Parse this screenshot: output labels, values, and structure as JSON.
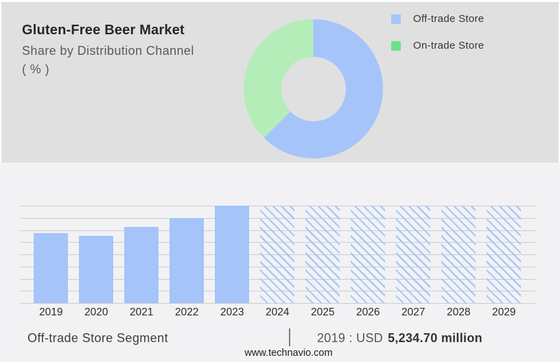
{
  "header": {
    "title": "Gluten-Free Beer Market",
    "subtitle": "Share by Distribution Channel",
    "unit": "( % )"
  },
  "legend": [
    {
      "label": "Off-trade Store",
      "color": "#a5c4fa"
    },
    {
      "label": "On-trade Store",
      "color": "#6ee18b"
    }
  ],
  "footer": {
    "segment_label": "Off-trade Store Segment",
    "value_prefix": "2019 : USD",
    "value_bold": "5,234.70 million",
    "website": "www.technavio.com"
  },
  "colors": {
    "top_band_bg": "#e0e0e1",
    "bottom_bg": "#f2f2f4",
    "bar_blue": "#a5c4fa",
    "hatch_blue": "#a9c7f8",
    "donut_blue": "#a5c4fa",
    "donut_green": "#b5edb8",
    "gridline": "#cccccc"
  },
  "chart_data": [
    {
      "type": "pie",
      "subtype": "donut",
      "title": "Gluten-Free Beer Market — Share by Distribution Channel (%)",
      "series": [
        {
          "name": "Off-trade Store",
          "value_pct": 62.5,
          "color": "#a5c4fa"
        },
        {
          "name": "On-trade Store",
          "value_pct": 37.5,
          "color": "#b5edb8"
        }
      ],
      "start_angle_deg": 0,
      "direction": "clockwise",
      "legend_position": "right",
      "values_estimated_from_arc": true
    },
    {
      "type": "bar",
      "categories": [
        "2019",
        "2020",
        "2021",
        "2022",
        "2023",
        "2024",
        "2025",
        "2026",
        "2027",
        "2028",
        "2029"
      ],
      "series": [
        {
          "name": "Off-trade Store segment size",
          "heights_pct_of_max": [
            71.8,
            68.9,
            78.4,
            87.6,
            100,
            100,
            100,
            100,
            100,
            100,
            100
          ],
          "values_usd_million": [
            5234.7,
            null,
            null,
            null,
            null,
            null,
            null,
            null,
            null,
            null,
            null
          ]
        }
      ],
      "forecast_from_index": 5,
      "forecast_style": "hatched",
      "annotation": "2019 : USD 5,234.70 million",
      "xlabel": "",
      "ylabel": "",
      "gridline_count": 9,
      "grid": true,
      "values_estimated": true
    }
  ]
}
